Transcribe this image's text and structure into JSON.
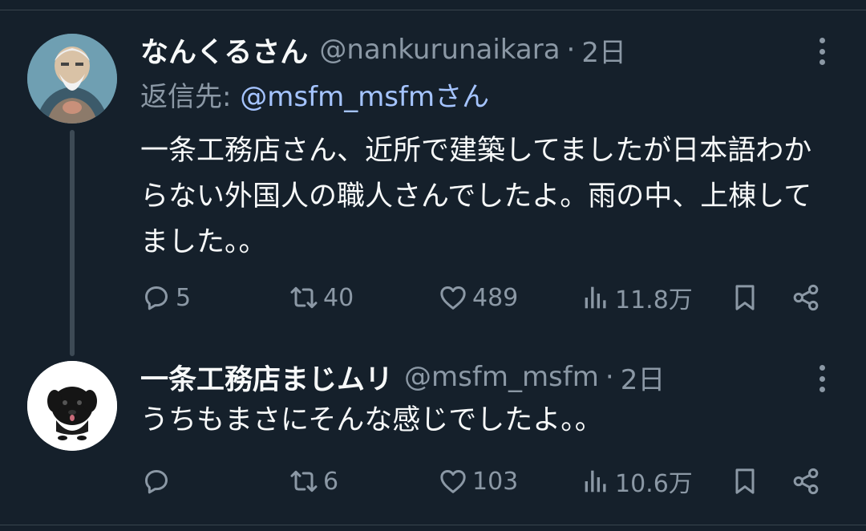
{
  "tweets": [
    {
      "display_name": "なんくるさん",
      "handle": "@nankurunaikara",
      "separator": "·",
      "time": "2日",
      "reply_label": "返信先: ",
      "reply_mention": "@msfm_msfmさん",
      "text": "一条工務店さん、近所で建築してましたが日本語わからない外国人の職人さんでしたよ。雨の中、上棟してました。。",
      "avatar_icon": "elder-avatar-icon",
      "stats": {
        "replies": "5",
        "retweets": "40",
        "likes": "489",
        "views": "11.8万"
      }
    },
    {
      "display_name": "一条工務店まじムリ",
      "handle": "@msfm_msfm",
      "separator": "·",
      "time": "2日",
      "text": "うちもまさにそんな感じでしたよ。。",
      "avatar_icon": "black-dog-avatar-icon",
      "stats": {
        "replies": "",
        "retweets": "6",
        "likes": "103",
        "views": "10.6万"
      }
    }
  ],
  "colors": {
    "background": "#15202b",
    "primary_text": "#f7f9f9",
    "secondary_text": "#8b98a5",
    "mention": "#a5c4ff",
    "divider": "#38444d"
  },
  "icons": [
    "reply-icon",
    "retweet-icon",
    "like-icon",
    "views-icon",
    "bookmark-icon",
    "share-icon",
    "more-icon"
  ]
}
